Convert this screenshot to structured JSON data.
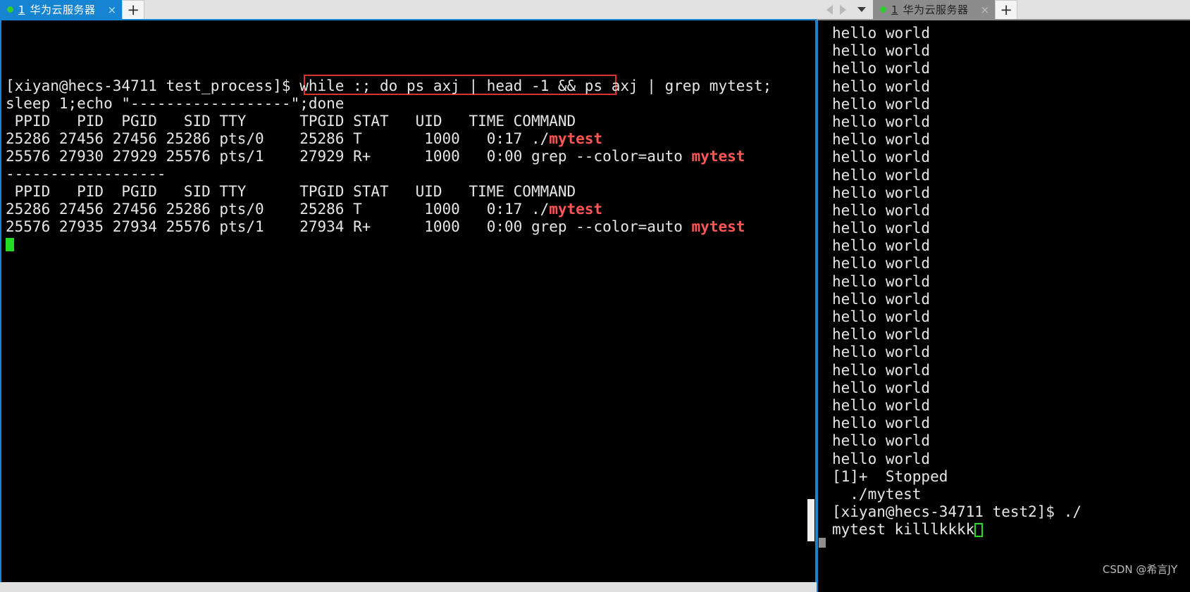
{
  "window_left": {
    "tabbar": {
      "tab": {
        "status_dot": "green-dot-icon",
        "number": "1",
        "title": "华为云服务器",
        "close_label": "×"
      },
      "new_tab_label": "+"
    },
    "terminal": {
      "lines": [
        "[xiyan@hecs-34711 test_process]$ while :; do ps axj | head -1 && ps axj | grep mytest;",
        "sleep 1;echo \"------------------\";done",
        " PPID   PID  PGID   SID TTY      TPGID STAT   UID   TIME COMMAND",
        "25286 27456 27456 25286 pts/0    25286 T       1000   0:17 ./mytest",
        "25576 27930 27929 25576 pts/1    27929 R+      1000   0:00 grep --color=auto mytest",
        "------------------",
        " PPID   PID  PGID   SID TTY      TPGID STAT   UID   TIME COMMAND",
        "25286 27456 27456 25286 pts/0    25286 T       1000   0:17 ./mytest",
        "25576 27935 27934 25576 pts/1    27934 R+      1000   0:00 grep --color=auto mytest"
      ],
      "line_segments": [
        [
          {
            "t": "[xiyan@hecs-34711 test_process]$ while :; do ps axj | head -1 && ps axj | grep mytest;",
            "c": "fg"
          }
        ],
        [
          {
            "t": "sleep 1;echo \"------------------\";done",
            "c": "fg"
          }
        ],
        [
          {
            "t": " PPID   PID  PGID   SID TTY      TPGID STAT   UID   TIME COMMAND",
            "c": "fg"
          }
        ],
        [
          {
            "t": "25286 27456 27456 25286 pts/0    25286 T       1000   0:17 ./",
            "c": "fg"
          },
          {
            "t": "mytest",
            "c": "red"
          }
        ],
        [
          {
            "t": "25576 27930 27929 25576 pts/1    27929 R+      1000   0:00 grep --color=auto ",
            "c": "fg"
          },
          {
            "t": "mytest",
            "c": "red"
          }
        ],
        [
          {
            "t": "------------------",
            "c": "fg"
          }
        ],
        [
          {
            "t": " PPID   PID  PGID   SID TTY      TPGID STAT   UID   TIME COMMAND",
            "c": "fg"
          }
        ],
        [
          {
            "t": "25286 27456 27456 25286 pts/0    25286 T       1000   0:17 ./",
            "c": "fg"
          },
          {
            "t": "mytest",
            "c": "red"
          }
        ],
        [
          {
            "t": "25576 27935 27934 25576 pts/1    27934 R+      1000   0:00 grep --color=auto ",
            "c": "fg"
          },
          {
            "t": "mytest",
            "c": "red"
          }
        ]
      ],
      "cursor": "block-cursor",
      "annotation": {
        "type": "red-rectangle",
        "target_text": "25286 T       1000   0:17 ./mytest",
        "color": "#e03131"
      }
    }
  },
  "window_right": {
    "nav": {
      "back_label": "back-arrow-icon",
      "forward_label": "forward-arrow-icon",
      "menu_label": "caret-down-icon"
    },
    "tabbar": {
      "tab": {
        "status_dot": "green-dot-icon",
        "number": "1",
        "title": "华为云服务器",
        "close_label": "×"
      },
      "new_tab_label": "+"
    },
    "terminal": {
      "line_segments": [
        [
          {
            "t": "hello world",
            "c": "fg"
          }
        ],
        [
          {
            "t": "hello world",
            "c": "fg"
          }
        ],
        [
          {
            "t": "hello world",
            "c": "fg"
          }
        ],
        [
          {
            "t": "hello world",
            "c": "fg"
          }
        ],
        [
          {
            "t": "hello world",
            "c": "fg"
          }
        ],
        [
          {
            "t": "hello world",
            "c": "fg"
          }
        ],
        [
          {
            "t": "hello world",
            "c": "fg"
          }
        ],
        [
          {
            "t": "hello world",
            "c": "fg"
          }
        ],
        [
          {
            "t": "hello world",
            "c": "fg"
          }
        ],
        [
          {
            "t": "hello world",
            "c": "fg"
          }
        ],
        [
          {
            "t": "hello world",
            "c": "fg"
          }
        ],
        [
          {
            "t": "hello world",
            "c": "fg"
          }
        ],
        [
          {
            "t": "hello world",
            "c": "fg"
          }
        ],
        [
          {
            "t": "hello world",
            "c": "fg"
          }
        ],
        [
          {
            "t": "hello world",
            "c": "fg"
          }
        ],
        [
          {
            "t": "hello world",
            "c": "fg"
          }
        ],
        [
          {
            "t": "hello world",
            "c": "fg"
          }
        ],
        [
          {
            "t": "hello world",
            "c": "fg"
          }
        ],
        [
          {
            "t": "hello world",
            "c": "fg"
          }
        ],
        [
          {
            "t": "hello world",
            "c": "fg"
          }
        ],
        [
          {
            "t": "hello world",
            "c": "fg"
          }
        ],
        [
          {
            "t": "hello world",
            "c": "fg"
          }
        ],
        [
          {
            "t": "hello world",
            "c": "fg"
          }
        ],
        [
          {
            "t": "hello world",
            "c": "fg"
          }
        ],
        [
          {
            "t": "hello world",
            "c": "fg"
          }
        ],
        [
          {
            "t": "[1]+  Stopped",
            "c": "fg"
          }
        ],
        [
          {
            "t": "  ./mytest",
            "c": "fg"
          }
        ],
        [
          {
            "t": "[xiyan@hecs-34711 test2]$ ./",
            "c": "fg"
          }
        ],
        [
          {
            "t": "mytest killlkkkk",
            "c": "fg"
          }
        ]
      ],
      "cursor": "hollow-cursor"
    }
  },
  "watermark": "CSDN @希言JY",
  "colors": {
    "accent_blue": "#1784d1",
    "terminal_bg": "#000000",
    "terminal_fg": "#e6e6e6",
    "highlight_red": "#ff5555",
    "annotation_red": "#e03131",
    "cursor_green": "#22dd22",
    "chrome_gray": "#e2e2e2",
    "inactive_tab": "#8c8c8c"
  }
}
